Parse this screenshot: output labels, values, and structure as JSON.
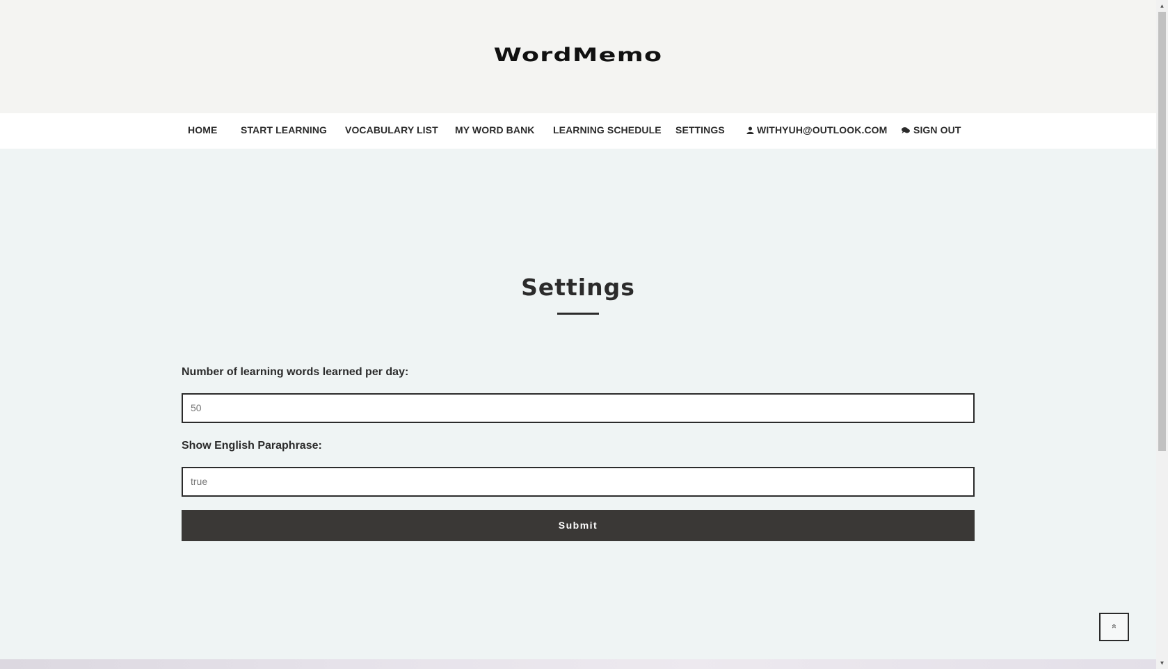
{
  "brand": {
    "logo_text": "WordMemo"
  },
  "nav": {
    "home": "HOME",
    "start_learning": "START LEARNING",
    "vocabulary_list": "VOCABULARY LIST",
    "my_word_bank": "MY WORD BANK",
    "learning_schedule": "LEARNING SCHEDULE",
    "settings": "SETTINGS",
    "account": "WITHYUH@OUTLOOK.COM",
    "account_icon": "user-icon",
    "sign_out": "SIGN OUT",
    "sign_out_icon": "comments-icon"
  },
  "main": {
    "title": "Settings",
    "words_per_day_label": "Number of learning words learned per day:",
    "words_per_day_value": "50",
    "paraphrase_label": "Show English Paraphrase:",
    "paraphrase_value": "true",
    "submit_label": "Submit"
  },
  "scroll_top": {
    "icon": "double-chevron-up-icon",
    "glyph": "«"
  },
  "colors": {
    "header_bg": "#f4f4f2",
    "page_bg": "#eff4f4",
    "text": "#2b2b2b",
    "button_bg": "#3a3836"
  }
}
